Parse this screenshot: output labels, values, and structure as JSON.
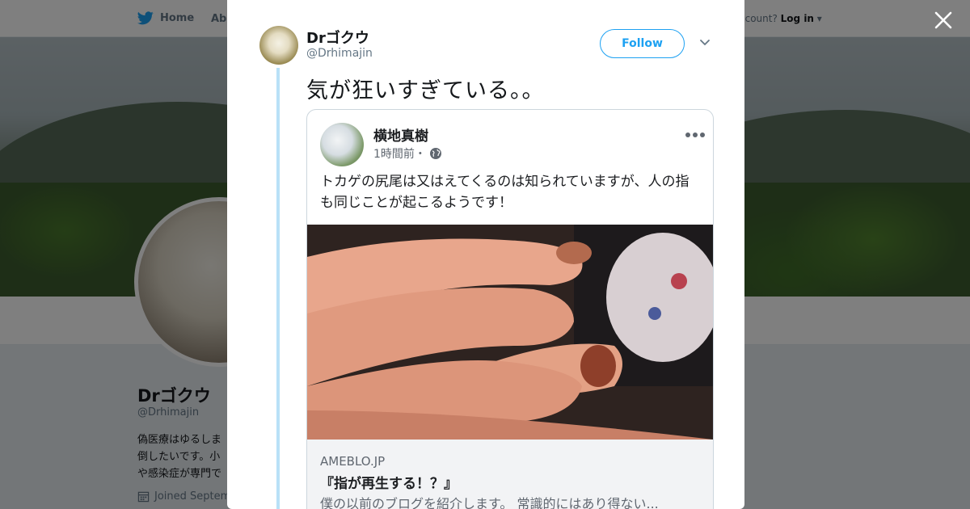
{
  "nav": {
    "home_label": "Home",
    "about_label": "Abo",
    "account_prefix": "ccount?",
    "login_label": "Log in"
  },
  "profile": {
    "name": "Drゴクウ",
    "handle": "@Drhimajin",
    "bio": "偽医療はゆるしま\n倒したいです。小\nや感染症が専門で",
    "joined": "Joined Septem"
  },
  "tweet": {
    "author_name": "Drゴクウ",
    "author_handle": "@Drhimajin",
    "follow_label": "Follow",
    "text": "気が狂いすぎている。。"
  },
  "embedded_post": {
    "name": "横地真樹",
    "time": "1時間前・",
    "text": "トカゲの尻尾は又はえてくるのは知られていますが、人の指も同じことが起こるようです！",
    "link_domain": "AMEBLO.JP",
    "link_title": "『指が再生する！？』",
    "link_description": "僕の以前のブログを紹介します。 常識的にはあり得ない..."
  },
  "colors": {
    "accent": "#1da1f2",
    "thread_line": "#b9e1f7",
    "overlay": "rgba(0,0,0,0.5)"
  },
  "icons": {
    "nav_home": "twitter-bird-icon",
    "close": "close-icon",
    "caret": "chevron-down-icon",
    "more": "more-dots-icon",
    "globe": "globe-icon",
    "calendar": "calendar-icon"
  }
}
